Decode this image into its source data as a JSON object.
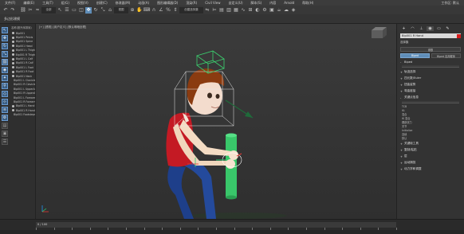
{
  "menubar": {
    "items": [
      "文件(F)",
      "编辑(E)",
      "工具(T)",
      "组(G)",
      "视图(V)",
      "创建(C)",
      "修改器(M)",
      "动画(A)",
      "图形编辑器(D)",
      "渲染(R)",
      "Civil View",
      "自定义(U)",
      "脚本(S)",
      "内容",
      "Arnold",
      "帮助(H)"
    ],
    "workspace": "工作区: 默认"
  },
  "toolbar": {
    "view_dropdown": "视图",
    "selection_set": "创建选择集"
  },
  "ribbon": {
    "label": "多边形建模"
  },
  "viewport": {
    "label": "[+] [透视] [用户定义] [默认明暗处理]"
  },
  "left_dock": {
    "icons": [
      "select-icon",
      "move-icon",
      "rotate-icon",
      "scale-icon",
      "link-icon",
      "camera-icon",
      "light-icon",
      "bone-icon",
      "shape-icon",
      "helper-icon",
      "spacewarp-icon",
      "system-icon",
      "layer-icon",
      "display-icon",
      "settings-icon"
    ]
  },
  "scene_explorer": {
    "header": "名称(按升序排序)",
    "items": [
      "Bip001",
      "Bip001 Pelvis",
      "Bip001 Spine",
      "Bip001 Head",
      "Bip001 L Thigh",
      "Bip001 R Thigh",
      "Bip001 L Calf",
      "Bip001 R Calf",
      "Bip001 L Foot",
      "Bip001 R Foot",
      "Bip001 Neck",
      "Bip001 L Clavicle",
      "Bip001 R Clavicle",
      "Bip001 L UpperArm",
      "Bip001 R UpperArm",
      "Bip001 L Forearm",
      "Bip001 R Forearm",
      "Bip001 L Hand",
      "Bip001 R Hand",
      "Bip001 Footsteps"
    ]
  },
  "command_panel": {
    "tabs": [
      "create-tab",
      "modify-tab",
      "hierarchy-tab",
      "motion-tab",
      "display-tab",
      "utilities-tab"
    ],
    "object_name": "Bip001 R Hand",
    "object_color": "#d81b1b",
    "category": "选择集",
    "btn_params": "参数",
    "btn_tracks": "轨迹",
    "btn_biped": "Biped",
    "btn_biped_app": "Biped 应用程序",
    "sections": [
      {
        "sign": "-",
        "label": "Biped"
      },
      {
        "sign": "+",
        "label": "轨迹选择"
      },
      {
        "sign": "+",
        "label": "四元数/Euler"
      },
      {
        "sign": "+",
        "label": "扭曲姿势"
      },
      {
        "sign": "+",
        "label": "弯曲链接"
      },
      {
        "sign": "-",
        "label": "关键点信息"
      },
      {
        "sign": "+",
        "label": "关键帧工具"
      },
      {
        "sign": "+",
        "label": "复制/粘贴"
      },
      {
        "sign": "+",
        "label": "层"
      },
      {
        "sign": "+",
        "label": "运动捕捉"
      },
      {
        "sign": "+",
        "label": "动力学和调整"
      }
    ],
    "controls": [
      "TCB",
      "IK:",
      "混合",
      "IK 混合",
      "踝部张力",
      "关节",
      "Initialize",
      "连续",
      "默认"
    ],
    "spinner_value": "0.0"
  },
  "timeline": {
    "frame": "0 / 100"
  }
}
